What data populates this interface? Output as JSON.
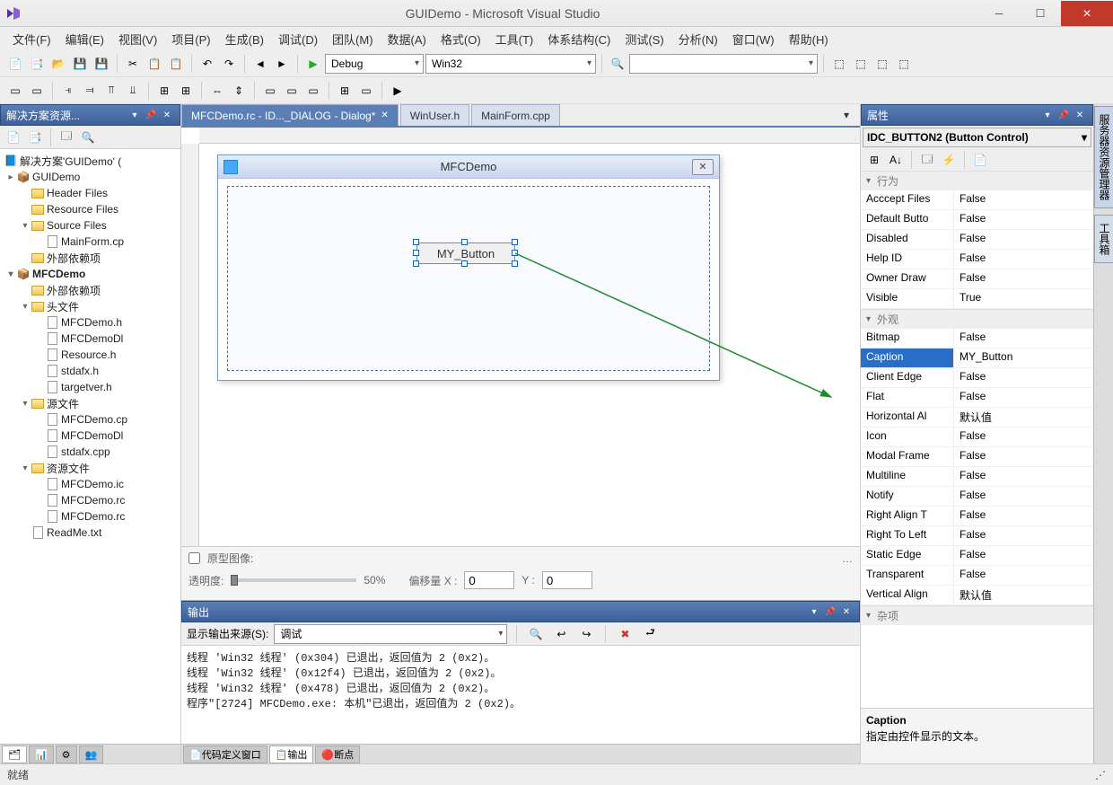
{
  "titlebar": {
    "title": "GUIDemo - Microsoft Visual Studio"
  },
  "menu": [
    "文件(F)",
    "编辑(E)",
    "视图(V)",
    "项目(P)",
    "生成(B)",
    "调试(D)",
    "团队(M)",
    "数据(A)",
    "格式(O)",
    "工具(T)",
    "体系结构(C)",
    "测试(S)",
    "分析(N)",
    "窗口(W)",
    "帮助(H)"
  ],
  "toolbar1": {
    "config": "Debug",
    "platform": "Win32"
  },
  "solution_panel": {
    "title": "解决方案资源...",
    "root": "解决方案'GUIDemo' (",
    "tree": [
      {
        "d": 0,
        "exp": "▸",
        "t": "GUIDemo",
        "ico": "proj"
      },
      {
        "d": 1,
        "exp": "",
        "t": "Header Files",
        "ico": "folder"
      },
      {
        "d": 1,
        "exp": "",
        "t": "Resource Files",
        "ico": "folder"
      },
      {
        "d": 1,
        "exp": "▾",
        "t": "Source Files",
        "ico": "folder"
      },
      {
        "d": 2,
        "exp": "",
        "t": "MainForm.cp",
        "ico": "cpp"
      },
      {
        "d": 1,
        "exp": "",
        "t": "外部依赖项",
        "ico": "folder"
      },
      {
        "d": 0,
        "exp": "▾",
        "t": "MFCDemo",
        "ico": "proj",
        "bold": true
      },
      {
        "d": 1,
        "exp": "",
        "t": "外部依赖项",
        "ico": "folder"
      },
      {
        "d": 1,
        "exp": "▾",
        "t": "头文件",
        "ico": "folder"
      },
      {
        "d": 2,
        "exp": "",
        "t": "MFCDemo.h",
        "ico": "h"
      },
      {
        "d": 2,
        "exp": "",
        "t": "MFCDemoDl",
        "ico": "h"
      },
      {
        "d": 2,
        "exp": "",
        "t": "Resource.h",
        "ico": "h"
      },
      {
        "d": 2,
        "exp": "",
        "t": "stdafx.h",
        "ico": "h"
      },
      {
        "d": 2,
        "exp": "",
        "t": "targetver.h",
        "ico": "h"
      },
      {
        "d": 1,
        "exp": "▾",
        "t": "源文件",
        "ico": "folder"
      },
      {
        "d": 2,
        "exp": "",
        "t": "MFCDemo.cp",
        "ico": "cpp"
      },
      {
        "d": 2,
        "exp": "",
        "t": "MFCDemoDl",
        "ico": "cpp"
      },
      {
        "d": 2,
        "exp": "",
        "t": "stdafx.cpp",
        "ico": "cpp"
      },
      {
        "d": 1,
        "exp": "▾",
        "t": "资源文件",
        "ico": "folder"
      },
      {
        "d": 2,
        "exp": "",
        "t": "MFCDemo.ic",
        "ico": "res"
      },
      {
        "d": 2,
        "exp": "",
        "t": "MFCDemo.rc",
        "ico": "res"
      },
      {
        "d": 2,
        "exp": "",
        "t": "MFCDemo.rc",
        "ico": "res"
      },
      {
        "d": 1,
        "exp": "",
        "t": "ReadMe.txt",
        "ico": "txt"
      }
    ]
  },
  "doctabs": [
    {
      "label": "MFCDemo.rc - ID..._DIALOG - Dialog*",
      "active": true
    },
    {
      "label": "WinUser.h",
      "active": false
    },
    {
      "label": "MainForm.cpp",
      "active": false
    }
  ],
  "dialog": {
    "title": "MFCDemo",
    "button_text": "MY_Button"
  },
  "designer_footer": {
    "proto_label": "原型图像:",
    "opacity_label": "透明度:",
    "opacity_value": "50%",
    "offset_label": "偏移量 X :",
    "x": "0",
    "y_label": "Y :",
    "y": "0"
  },
  "output": {
    "title": "输出",
    "source_label": "显示输出来源(S):",
    "source_value": "调试",
    "lines": [
      "线程 'Win32 线程' (0x304) 已退出，返回值为 2 (0x2)。",
      "线程 'Win32 线程' (0x12f4) 已退出，返回值为 2 (0x2)。",
      "线程 'Win32 线程' (0x478) 已退出，返回值为 2 (0x2)。",
      "程序\"[2724] MFCDemo.exe: 本机\"已退出，返回值为 2 (0x2)。"
    ]
  },
  "bottom_tabs": [
    "代码定义窗口",
    "输出",
    "断点"
  ],
  "bottom_tabs_active": 1,
  "properties": {
    "title": "属性",
    "selector": "IDC_BUTTON2 (Button Control)",
    "cats": [
      {
        "name": "行为",
        "rows": [
          [
            "Acccept Files",
            "False"
          ],
          [
            "Default Butto",
            "False"
          ],
          [
            "Disabled",
            "False"
          ],
          [
            "Help ID",
            "False"
          ],
          [
            "Owner Draw",
            "False"
          ],
          [
            "Visible",
            "True"
          ]
        ]
      },
      {
        "name": "外观",
        "rows": [
          [
            "Bitmap",
            "False"
          ],
          [
            "Caption",
            "MY_Button"
          ],
          [
            "Client Edge",
            "False"
          ],
          [
            "Flat",
            "False"
          ],
          [
            "Horizontal Al",
            "默认值"
          ],
          [
            "Icon",
            "False"
          ],
          [
            "Modal Frame",
            "False"
          ],
          [
            "Multiline",
            "False"
          ],
          [
            "Notify",
            "False"
          ],
          [
            "Right Align T",
            "False"
          ],
          [
            "Right To Left",
            "False"
          ],
          [
            "Static Edge",
            "False"
          ],
          [
            "Transparent",
            "False"
          ],
          [
            "Vertical Align",
            "默认值"
          ]
        ]
      },
      {
        "name": "杂项",
        "rows": []
      }
    ],
    "selected_row": "Caption",
    "desc_title": "Caption",
    "desc_text": "指定由控件显示的文本。"
  },
  "side_tabs": [
    "服务器资源管理器",
    "工具箱"
  ],
  "status": "就绪"
}
